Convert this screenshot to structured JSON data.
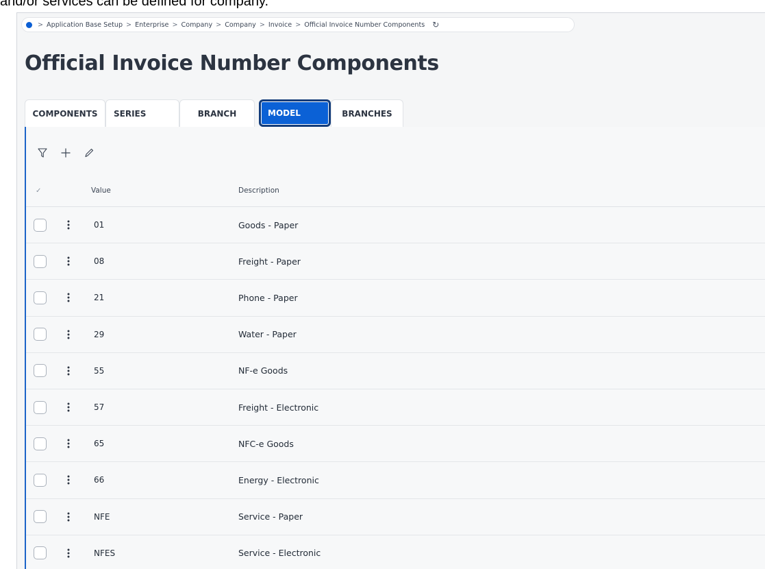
{
  "caption": "and/or services can be defined for company.",
  "breadcrumb": {
    "items": [
      "Application Base Setup",
      "Enterprise",
      "Company",
      "Company",
      "Invoice",
      "Official Invoice Number Components"
    ]
  },
  "page": {
    "title": "Official Invoice Number Components"
  },
  "tabs": [
    {
      "label": "COMPONENTS",
      "active": false
    },
    {
      "label": "SERIES",
      "active": false
    },
    {
      "label": "BRANCH",
      "active": false
    },
    {
      "label": "MODEL",
      "active": true
    },
    {
      "label": "BRANCHES",
      "active": false
    }
  ],
  "toolbar": {
    "icons": [
      "filter-icon",
      "add-icon",
      "edit-icon"
    ]
  },
  "table": {
    "columns": [
      "Value",
      "Description"
    ],
    "rows": [
      {
        "value": "01",
        "description": "Goods - Paper"
      },
      {
        "value": "08",
        "description": "Freight - Paper"
      },
      {
        "value": "21",
        "description": "Phone - Paper"
      },
      {
        "value": "29",
        "description": "Water - Paper"
      },
      {
        "value": "55",
        "description": "NF-e Goods"
      },
      {
        "value": "57",
        "description": "Freight - Electronic"
      },
      {
        "value": "65",
        "description": "NFC-e Goods"
      },
      {
        "value": "66",
        "description": "Energy - Electronic"
      },
      {
        "value": "NFE",
        "description": "Service - Paper"
      },
      {
        "value": "NFES",
        "description": "Service - Electronic"
      }
    ]
  },
  "colors": {
    "accent": "#0b61d6",
    "panel_border": "#1b64c8"
  }
}
